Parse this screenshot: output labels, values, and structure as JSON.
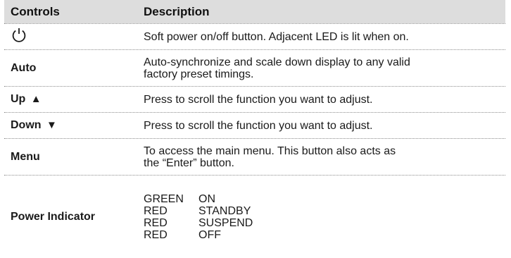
{
  "table": {
    "header": {
      "controls": "Controls",
      "description": "Description"
    },
    "rows": [
      {
        "control": "",
        "icon": "power-icon",
        "description": "Soft power on/off button. Adjacent LED is lit when on."
      },
      {
        "control": "Auto",
        "description_lines": [
          "Auto-synchronize and scale down display to any valid",
          "factory preset timings."
        ]
      },
      {
        "control": "Up",
        "symbol": "▲",
        "description": "Press to scroll the function you want to adjust."
      },
      {
        "control": "Down",
        "symbol": "▼",
        "description": "Press to scroll the function you want to adjust."
      },
      {
        "control": "Menu",
        "description_lines": [
          "To access the main menu. This button also acts as",
          "the “Enter” button."
        ]
      },
      {
        "control": "Power Indicator",
        "states": [
          {
            "color": "GREEN",
            "status": "ON"
          },
          {
            "color": "RED",
            "status": "STANDBY"
          },
          {
            "color": "RED",
            "status": "SUSPEND"
          },
          {
            "color": "RED",
            "status": "OFF"
          }
        ]
      }
    ]
  }
}
